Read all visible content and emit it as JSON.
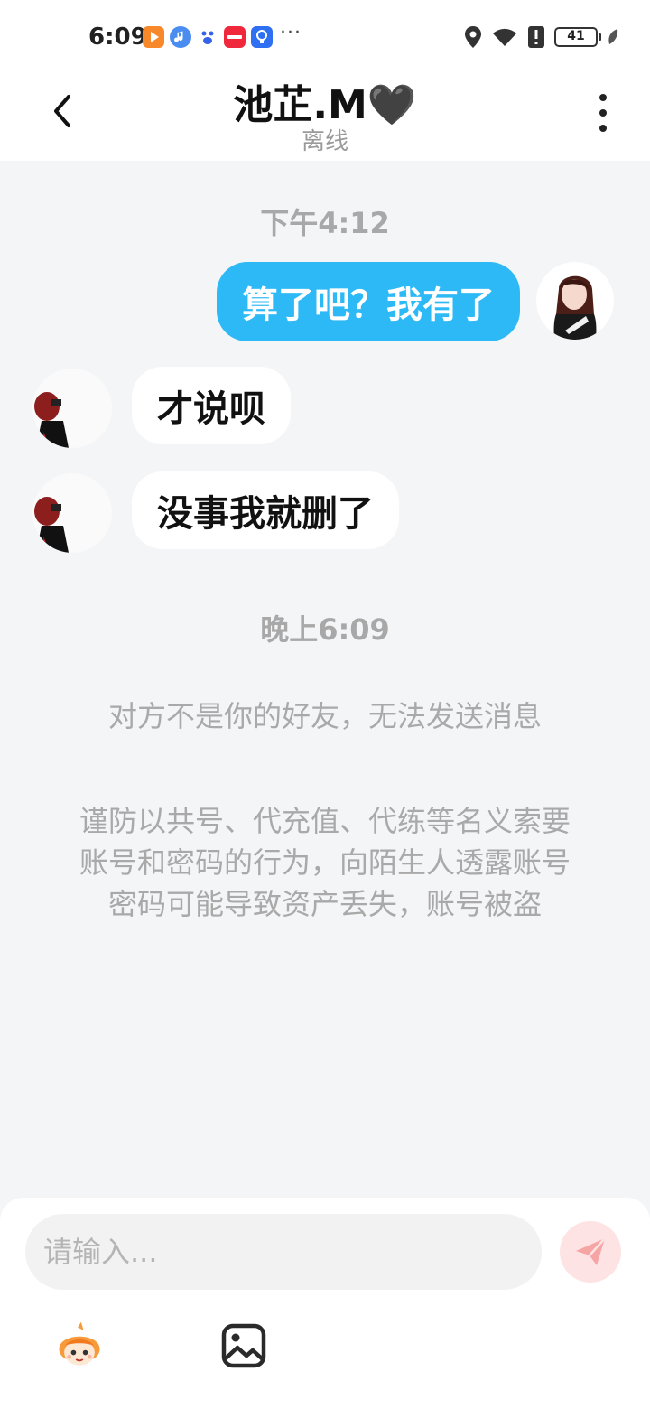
{
  "status_bar": {
    "time": "6:09",
    "more": "···",
    "battery": "41"
  },
  "header": {
    "title": "池芷.M🖤",
    "subtitle": "离线"
  },
  "messages": [
    {
      "type": "time",
      "text": "下午4:12"
    },
    {
      "type": "outgoing",
      "text": "算了吧？我有了"
    },
    {
      "type": "incoming",
      "text": "才说呗"
    },
    {
      "type": "incoming",
      "text": "没事我就删了"
    },
    {
      "type": "time",
      "text": "晚上6:09"
    }
  ],
  "notice": "对方不是你的好友，无法发送消息",
  "warning": "谨防以共号、代充值、代练等名义索要账号和密码的行为，向陌生人透露账号密码可能导致资产丢失，账号被盗",
  "input": {
    "placeholder": "请输入..."
  },
  "colors": {
    "outgoing_bubble": "#2db9f5",
    "send_button_bg": "#fde3e3",
    "send_icon": "#f6a5a5"
  }
}
